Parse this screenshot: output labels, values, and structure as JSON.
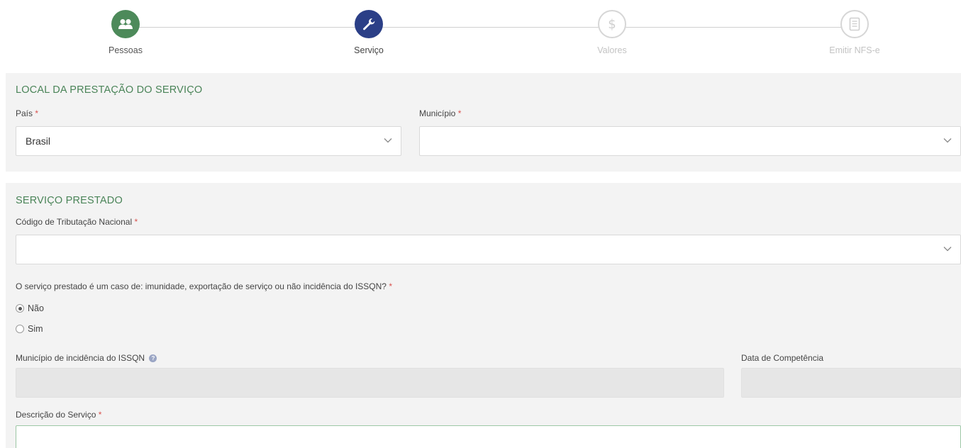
{
  "stepper": {
    "steps": [
      {
        "label": "Pessoas",
        "icon": "people-icon",
        "state": "done"
      },
      {
        "label": "Serviço",
        "icon": "wrench-icon",
        "state": "active"
      },
      {
        "label": "Valores",
        "icon": "dollar-icon",
        "state": "todo"
      },
      {
        "label": "Emitir NFS-e",
        "icon": "document-icon",
        "state": "todo"
      }
    ]
  },
  "local": {
    "title": "LOCAL DA PRESTAÇÃO DO SERVIÇO",
    "pais_label": "País",
    "pais_value": "Brasil",
    "municipio_label": "Município",
    "municipio_value": ""
  },
  "servico": {
    "title": "SERVIÇO PRESTADO",
    "codigo_label": "Código de Tributação Nacional",
    "codigo_value": "",
    "question": "O serviço prestado é um caso de: imunidade, exportação de serviço ou não incidência do ISSQN?",
    "options": [
      {
        "label": "Não",
        "checked": true
      },
      {
        "label": "Sim",
        "checked": false
      }
    ],
    "municipio_incidencia_label": "Município de incidência do ISSQN",
    "data_competencia_label": "Data de Competência",
    "descricao_label": "Descrição do Serviço",
    "required_mark": "*",
    "info_mark": "?"
  },
  "colors": {
    "done": "#4d8a5a",
    "active": "#2b3f87",
    "section_title": "#4a8458",
    "required": "#d9534f"
  }
}
